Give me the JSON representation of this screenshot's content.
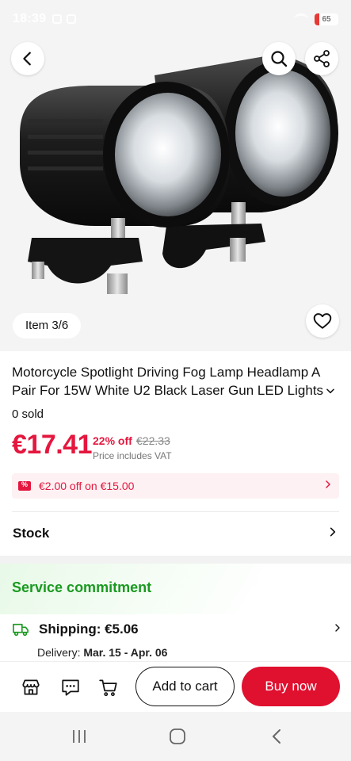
{
  "status_bar": {
    "time": "18:39",
    "battery": "65"
  },
  "gallery": {
    "item_label": "Item 3/6"
  },
  "product": {
    "title": "Motorcycle Spotlight Driving Fog Lamp Headlamp A Pair For 15W White U2 Black Laser Gun LED Lights",
    "sold": "0 sold",
    "price": "€17.41",
    "discount": "22% off",
    "original_price": "€22.33",
    "vat_note": "Price includes VAT",
    "coupon": "€2.00 off on €15.00"
  },
  "stock": {
    "label": "Stock"
  },
  "service": {
    "title": "Service commitment",
    "shipping_label": "Shipping: €5.06",
    "delivery_prefix": "Delivery: ",
    "delivery_dates": "Mar. 15 - Apr. 06"
  },
  "actions": {
    "add_to_cart": "Add to cart",
    "buy_now": "Buy now"
  },
  "colors": {
    "accent": "#e0102f",
    "price": "#e5173f",
    "service_green": "#1a9a20",
    "coupon_bg": "#fdf1f3"
  },
  "icons": [
    "back-arrow-icon",
    "search-icon",
    "share-icon",
    "heart-icon",
    "chevron-down-icon",
    "coupon-icon",
    "chevron-right-icon",
    "truck-icon",
    "store-icon",
    "chat-icon",
    "cart-icon"
  ]
}
